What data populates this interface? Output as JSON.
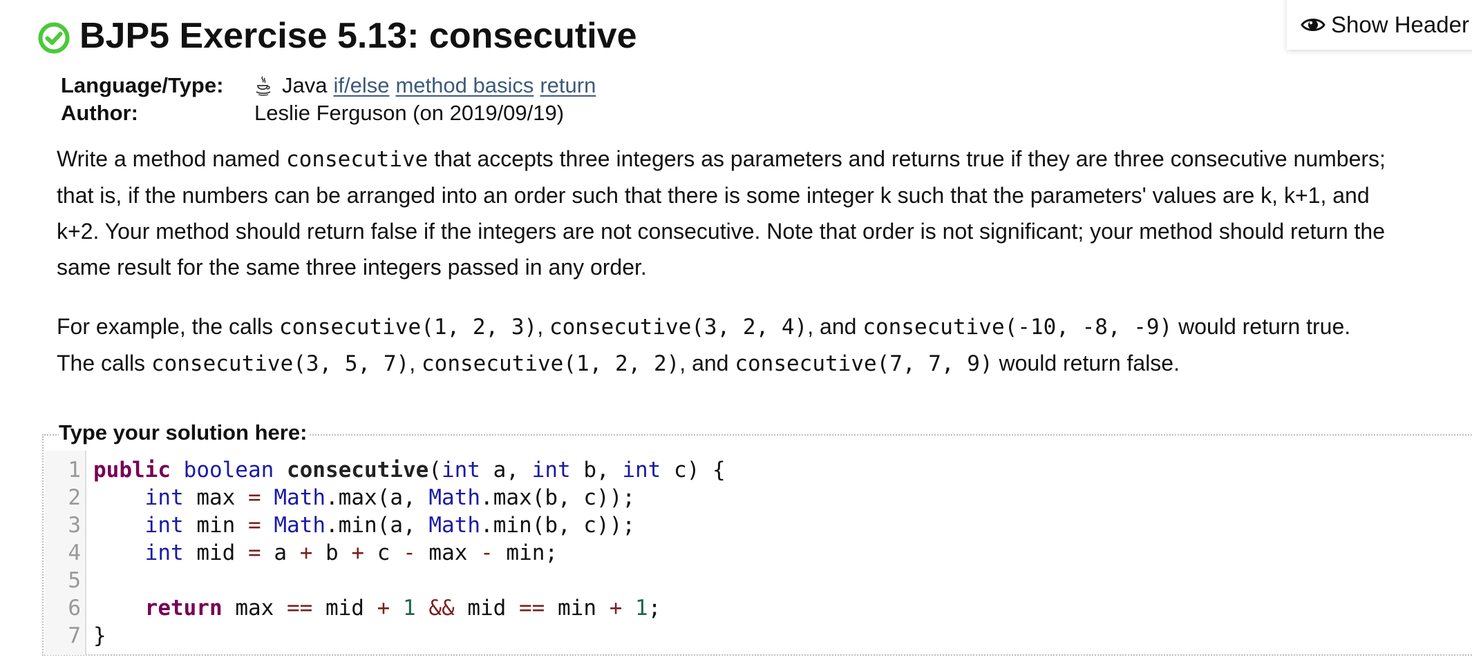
{
  "header_toggle": {
    "label": "Show Header",
    "icon": "eye-icon"
  },
  "problem": {
    "status_icon": "check-circle-icon",
    "status_color": "#4cc93a",
    "title": "BJP5 Exercise 5.13: consecutive",
    "meta": {
      "language_label": "Language/Type:",
      "language_icon": "java-cup-icon",
      "language": "Java",
      "tags": [
        "if/else",
        "method basics",
        "return"
      ],
      "author_label": "Author:",
      "author": "Leslie Ferguson (on 2019/09/19)"
    },
    "description": {
      "p1": {
        "pre": "Write a method named ",
        "code": "consecutive",
        "post": " that accepts three integers as parameters and returns true if they are three consecutive numbers;",
        "line2": "that is, if the numbers can be arranged into an order such that there is some integer k such that the parameters' values are k, k+1, and",
        "line3": "k+2. Your method should return false if the integers are not consecutive. Note that order is not significant; your method should return the",
        "line4": "same result for the same three integers passed in any order."
      },
      "p2": {
        "t1": "For example, the calls ",
        "c1": "consecutive(1, 2, 3)",
        "t2": ", ",
        "c2": "consecutive(3, 2, 4)",
        "t3": ", and ",
        "c3": "consecutive(-10, -8, -9)",
        "t4": " would return true.",
        "t5": "The calls ",
        "c4": "consecutive(3, 5, 7)",
        "t6": ", ",
        "c5": "consecutive(1, 2, 2)",
        "t7": ", and ",
        "c6": "consecutive(7, 7, 9)",
        "t8": " would return false."
      }
    }
  },
  "solution": {
    "legend": "Type your solution here:",
    "line_numbers": [
      "1",
      "2",
      "3",
      "4",
      "5",
      "6",
      "7"
    ],
    "code_lines": [
      "public boolean consecutive(int a, int b, int c) {",
      "    int max = Math.max(a, Math.max(b, c));",
      "    int min = Math.min(a, Math.min(b, c));",
      "    int mid = a + b + c - max - min;",
      "",
      "    return max == mid + 1 && mid == min + 1;",
      "}"
    ],
    "syntax_colors": {
      "keyword": "#770055",
      "type": "#1a1aa6",
      "operator": "#7a1f1f",
      "number": "#1f6647"
    }
  },
  "theme": {
    "link_color": "#3d5a7a"
  }
}
